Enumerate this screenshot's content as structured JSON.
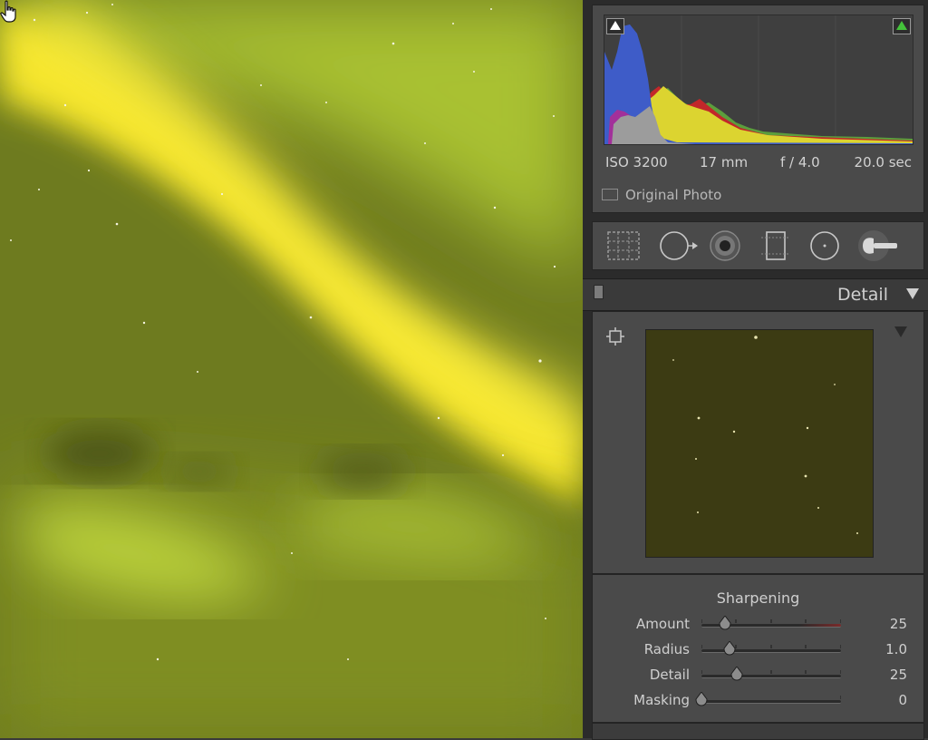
{
  "histogram": {
    "exif": {
      "iso": "ISO 3200",
      "focal": "17 mm",
      "aperture": "f / 4.0",
      "shutter": "20.0 sec"
    },
    "original_photo_label": "Original Photo",
    "shadow_clip_icon": "white-triangle-icon",
    "highlight_clip_icon": "green-triangle-icon",
    "highlight_clip_color": "#44c23a"
  },
  "tools": [
    "crop-overlay-icon",
    "spot-removal-icon",
    "red-eye-icon",
    "graduated-filter-icon",
    "radial-filter-icon",
    "adjustment-brush-icon"
  ],
  "detail_panel": {
    "title": "Detail",
    "sharpening": {
      "title": "Sharpening",
      "sliders": [
        {
          "label": "Amount",
          "value": "25",
          "fraction": 0.17
        },
        {
          "label": "Radius",
          "value": "1.0",
          "fraction": 0.2
        },
        {
          "label": "Detail",
          "value": "25",
          "fraction": 0.25
        },
        {
          "label": "Masking",
          "value": "0",
          "fraction": 0.0
        }
      ]
    }
  },
  "colors": {
    "photo_green": "#6d7a1e",
    "aurora_yellow": "#f6e82e",
    "panel_bg": "#4a4a4a"
  }
}
